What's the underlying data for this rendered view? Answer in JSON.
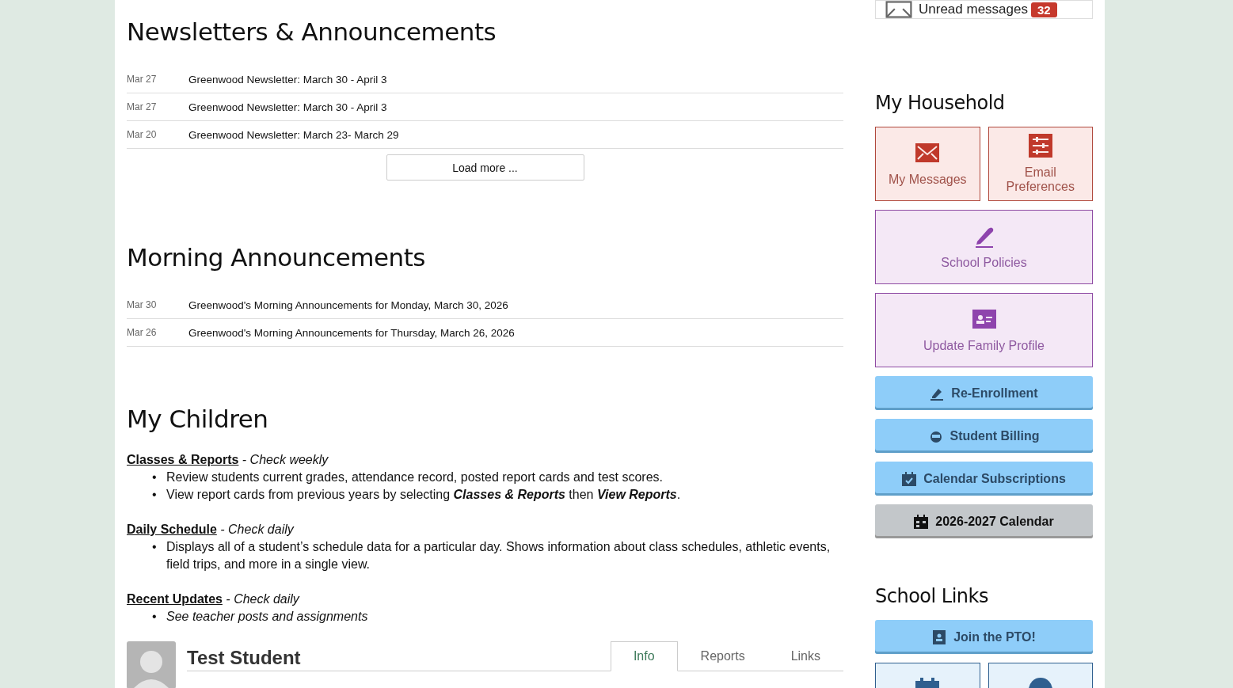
{
  "newsletters": {
    "title": "Newsletters & Announcements",
    "items": [
      {
        "date": "Mar 27",
        "title": "Greenwood Newsletter: March 30 - April 3"
      },
      {
        "date": "Mar 27",
        "title": "Greenwood Newsletter: March 30 - April 3"
      },
      {
        "date": "Mar 20",
        "title": "Greenwood Newsletter: March 23- March 29"
      }
    ],
    "load_more": "Load more ..."
  },
  "morning": {
    "title": "Morning Announcements",
    "items": [
      {
        "date": "Mar 30",
        "title": "Greenwood's Morning Announcements for Monday, March 30, 2026"
      },
      {
        "date": "Mar 26",
        "title": "Greenwood's Morning Announcements for Thursday, March 26, 2026"
      }
    ]
  },
  "children": {
    "title": "My Children",
    "sections": [
      {
        "link": "Classes & Reports",
        "note": "- Check weekly",
        "bullets": [
          {
            "marker": "•",
            "text": "Review students current grades, attendance record, posted report cards and test scores.",
            "italic": false
          },
          {
            "marker": "•",
            "text": "View report cards from previous years by selecting **Classes & Reports** then **View Reports**.",
            "italic": false
          }
        ]
      },
      {
        "link": "Daily Schedule",
        "note": "- Check daily",
        "bullets": [
          {
            "marker": "•",
            "text": "Displays all of a student’s schedule data for a particular day. Shows information about class schedules, athletic events, field trips, and more in a single view.",
            "italic": false
          }
        ]
      },
      {
        "link": "Recent Updates",
        "note": "- Check daily",
        "bullets": [
          {
            "marker": "•",
            "text": "See teacher posts and assignments",
            "italic": true
          }
        ]
      }
    ]
  },
  "student": {
    "name": "Test Student",
    "tabs": [
      {
        "label": "Info",
        "selected": true
      },
      {
        "label": "Reports",
        "selected": false
      },
      {
        "label": "Links",
        "selected": false
      }
    ]
  },
  "unread": {
    "label": "Unread messages",
    "count": "32"
  },
  "household": {
    "title": "My Household",
    "tiles": [
      {
        "label": "My Messages",
        "kind": "rose"
      },
      {
        "label": "Email Preferences",
        "kind": "rose"
      },
      {
        "label": "School Policies",
        "kind": "violet"
      },
      {
        "label": "Update Family Profile",
        "kind": "violet"
      }
    ],
    "buttons": [
      {
        "label": "Re-Enrollment",
        "kind": "blue"
      },
      {
        "label": "Student Billing",
        "kind": "blue"
      },
      {
        "label": "Calendar Subscriptions",
        "kind": "blue"
      },
      {
        "label": "2026-2027 Calendar",
        "kind": "gray"
      }
    ]
  },
  "school_links": {
    "title": "School Links",
    "buttons": [
      {
        "label": "Join the PTO!",
        "kind": "blue"
      }
    ],
    "tiles": [
      {
        "kind": "sky"
      },
      {
        "kind": "sky"
      }
    ]
  }
}
